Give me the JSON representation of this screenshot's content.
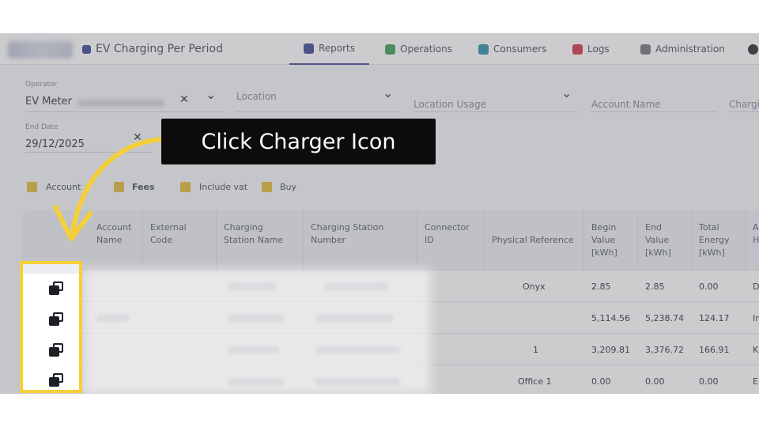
{
  "header": {
    "page_title": "EV Charging Per Period",
    "nav": [
      {
        "label": "Reports",
        "icon": "reports-icon",
        "color": "#2f3c8f"
      },
      {
        "label": "Operations",
        "icon": "operations-icon",
        "color": "#2e9b4a"
      },
      {
        "label": "Consumers",
        "icon": "consumers-icon",
        "color": "#1f8aa0"
      },
      {
        "label": "Logs",
        "icon": "logs-icon",
        "color": "#d12b3b"
      },
      {
        "label": "Administration",
        "icon": "administration-icon",
        "color": "#6b6f78"
      }
    ]
  },
  "filters": {
    "operator_label": "Operator",
    "operator_value": "EV Meter",
    "location_placeholder": "Location",
    "location_usage_placeholder": "Location Usage",
    "account_name_placeholder": "Account Name",
    "charger_placeholder": "Chargi",
    "end_date_label": "End Date",
    "end_date_value": "29/12/2025",
    "clear_symbol": "✕",
    "dropdown_symbol": "⌄",
    "checkboxes": [
      {
        "label": "Account",
        "checked": true
      },
      {
        "label": "Fees",
        "checked": true
      },
      {
        "label": "Include vat",
        "checked": true
      },
      {
        "label": "Buy",
        "checked": true
      }
    ]
  },
  "table": {
    "columns": [
      "Account Name",
      "External Code",
      "Charging Station Name",
      "Charging Station Number",
      "Connector ID",
      "Physical Reference",
      "Begin Value [kWh]",
      "End Value [kWh]",
      "Total Energy [kWh]",
      "A H"
    ],
    "rows": [
      {
        "physical_reference": "Onyx",
        "begin": "2.85",
        "end": "2.85",
        "total": "0.00",
        "last": "D"
      },
      {
        "physical_reference": "",
        "begin": "5,114.56",
        "end": "5,238.74",
        "total": "124.17",
        "last": "In"
      },
      {
        "physical_reference": "1",
        "begin": "3,209.81",
        "end": "3,376.72",
        "total": "166.91",
        "last": "K"
      },
      {
        "physical_reference": "Office 1",
        "begin": "0.00",
        "end": "0.00",
        "total": "0.00",
        "last": "E"
      }
    ]
  },
  "callout": {
    "text": "Click Charger Icon",
    "accent_color": "#f5cf3a"
  }
}
